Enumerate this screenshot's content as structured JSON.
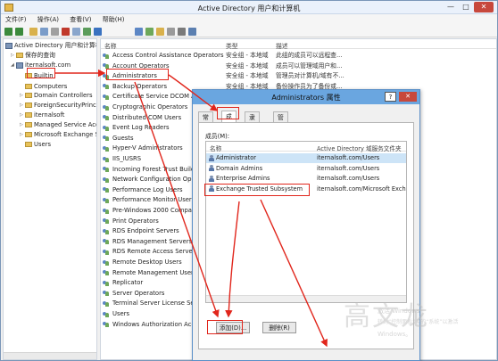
{
  "window": {
    "title": "Active Directory 用户和计算机"
  },
  "menu": [
    "文件(F)",
    "操作(A)",
    "查看(V)",
    "帮助(H)"
  ],
  "tree": {
    "root": "Active Directory 用户和计算机",
    "saved_queries": "保存的查询",
    "domain": "iternalsoft.com",
    "children": [
      "Builtin",
      "Computers",
      "Domain Controllers",
      "ForeignSecurityPrincipals",
      "iternalsoft",
      "Managed Service Accounts",
      "Microsoft Exchange Security Groups",
      "Users"
    ]
  },
  "list": {
    "columns": {
      "name": "名称",
      "type": "类型",
      "desc": "描述"
    },
    "items": [
      {
        "name": "Access Control Assistance Operators",
        "type": "安全组 - 本地域",
        "desc": "此组的成员可以远程查..."
      },
      {
        "name": "Account Operators",
        "type": "安全组 - 本地域",
        "desc": "成员可以管理域用户和..."
      },
      {
        "name": "Administrators",
        "type": "安全组 - 本地域",
        "desc": "管理员对计算机/域有不..."
      },
      {
        "name": "Backup Operators",
        "type": "安全组 - 本地域",
        "desc": "备份操作员为了备份或..."
      },
      {
        "name": "Certificate Service DCOM Access",
        "type": "",
        "desc": ""
      },
      {
        "name": "Cryptographic Operators",
        "type": "",
        "desc": ""
      },
      {
        "name": "Distributed COM Users",
        "type": "",
        "desc": ""
      },
      {
        "name": "Event Log Readers",
        "type": "",
        "desc": ""
      },
      {
        "name": "Guests",
        "type": "",
        "desc": ""
      },
      {
        "name": "Hyper-V Administrators",
        "type": "",
        "desc": ""
      },
      {
        "name": "IIS_IUSRS",
        "type": "",
        "desc": ""
      },
      {
        "name": "Incoming Forest Trust Builders",
        "type": "",
        "desc": ""
      },
      {
        "name": "Network Configuration Operators",
        "type": "",
        "desc": ""
      },
      {
        "name": "Performance Log Users",
        "type": "",
        "desc": ""
      },
      {
        "name": "Performance Monitor Users",
        "type": "",
        "desc": ""
      },
      {
        "name": "Pre-Windows 2000 Compatible Access",
        "type": "",
        "desc": ""
      },
      {
        "name": "Print Operators",
        "type": "",
        "desc": ""
      },
      {
        "name": "RDS Endpoint Servers",
        "type": "",
        "desc": ""
      },
      {
        "name": "RDS Management Servers",
        "type": "",
        "desc": ""
      },
      {
        "name": "RDS Remote Access Servers",
        "type": "",
        "desc": ""
      },
      {
        "name": "Remote Desktop Users",
        "type": "",
        "desc": ""
      },
      {
        "name": "Remote Management Users",
        "type": "",
        "desc": ""
      },
      {
        "name": "Replicator",
        "type": "",
        "desc": ""
      },
      {
        "name": "Server Operators",
        "type": "",
        "desc": ""
      },
      {
        "name": "Terminal Server License Servers",
        "type": "",
        "desc": ""
      },
      {
        "name": "Users",
        "type": "",
        "desc": ""
      },
      {
        "name": "Windows Authorization Access Group",
        "type": "",
        "desc": ""
      }
    ]
  },
  "dialog": {
    "title": "Administrators 属性",
    "help": "?",
    "close": "✕",
    "tabs": [
      "常规",
      "成员",
      "隶属于",
      "管理者"
    ],
    "members_label": "成员(M):",
    "columns": {
      "name": "名称",
      "folder": "Active Directory 域服务文件夹"
    },
    "members": [
      {
        "name": "Administrator",
        "folder": "iternalsoft.com/Users"
      },
      {
        "name": "Domain Admins",
        "folder": "iternalsoft.com/Users"
      },
      {
        "name": "Enterprise Admins",
        "folder": "iternalsoft.com/Users"
      },
      {
        "name": "Exchange Trusted Subsystem",
        "folder": "iternalsoft.com/Microsoft Excha"
      }
    ],
    "add_button": "添加(D)...",
    "remove_button": "删除(R)"
  },
  "watermark": {
    "big": "高文龙",
    "line1": "激活 Windows",
    "line2": "转到“控制面板”中的“系统”以激活",
    "line3": "Windows。"
  },
  "colors": {
    "annotation": "#e1261c",
    "dialog_title": "#6aa6e0",
    "selection": "#cde4f7"
  }
}
